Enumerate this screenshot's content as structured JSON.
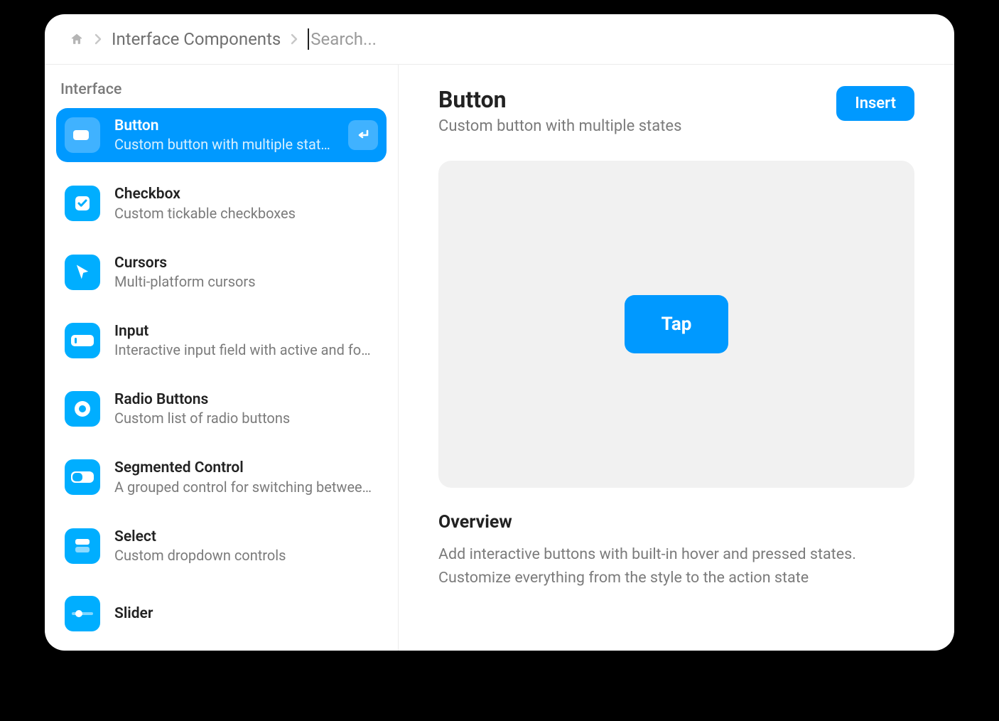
{
  "breadcrumb": {
    "section": "Interface Components"
  },
  "search": {
    "placeholder": "Search...",
    "value": ""
  },
  "sidebar": {
    "section_label": "Interface",
    "items": [
      {
        "title": "Button",
        "subtitle": "Custom button with multiple states",
        "icon": "button-icon",
        "active": true
      },
      {
        "title": "Checkbox",
        "subtitle": "Custom tickable checkboxes",
        "icon": "checkbox-icon",
        "active": false
      },
      {
        "title": "Cursors",
        "subtitle": "Multi-platform cursors",
        "icon": "cursor-icon",
        "active": false
      },
      {
        "title": "Input",
        "subtitle": "Interactive input field with active and focus states",
        "icon": "input-icon",
        "active": false
      },
      {
        "title": "Radio Buttons",
        "subtitle": "Custom list of radio buttons",
        "icon": "radio-icon",
        "active": false
      },
      {
        "title": "Segmented Control",
        "subtitle": "A grouped control for switching between options",
        "icon": "segmented-icon",
        "active": false
      },
      {
        "title": "Select",
        "subtitle": "Custom dropdown controls",
        "icon": "select-icon",
        "active": false
      },
      {
        "title": "Slider",
        "subtitle": "",
        "icon": "slider-icon",
        "active": false
      }
    ]
  },
  "detail": {
    "title": "Button",
    "subtitle": "Custom button with multiple states",
    "insert_label": "Insert",
    "preview_button_label": "Tap",
    "overview_heading": "Overview",
    "overview_body": "Add interactive buttons with built-in hover and pressed states. Customize everything from the style to the action state"
  },
  "colors": {
    "accent": "#0099ff"
  }
}
